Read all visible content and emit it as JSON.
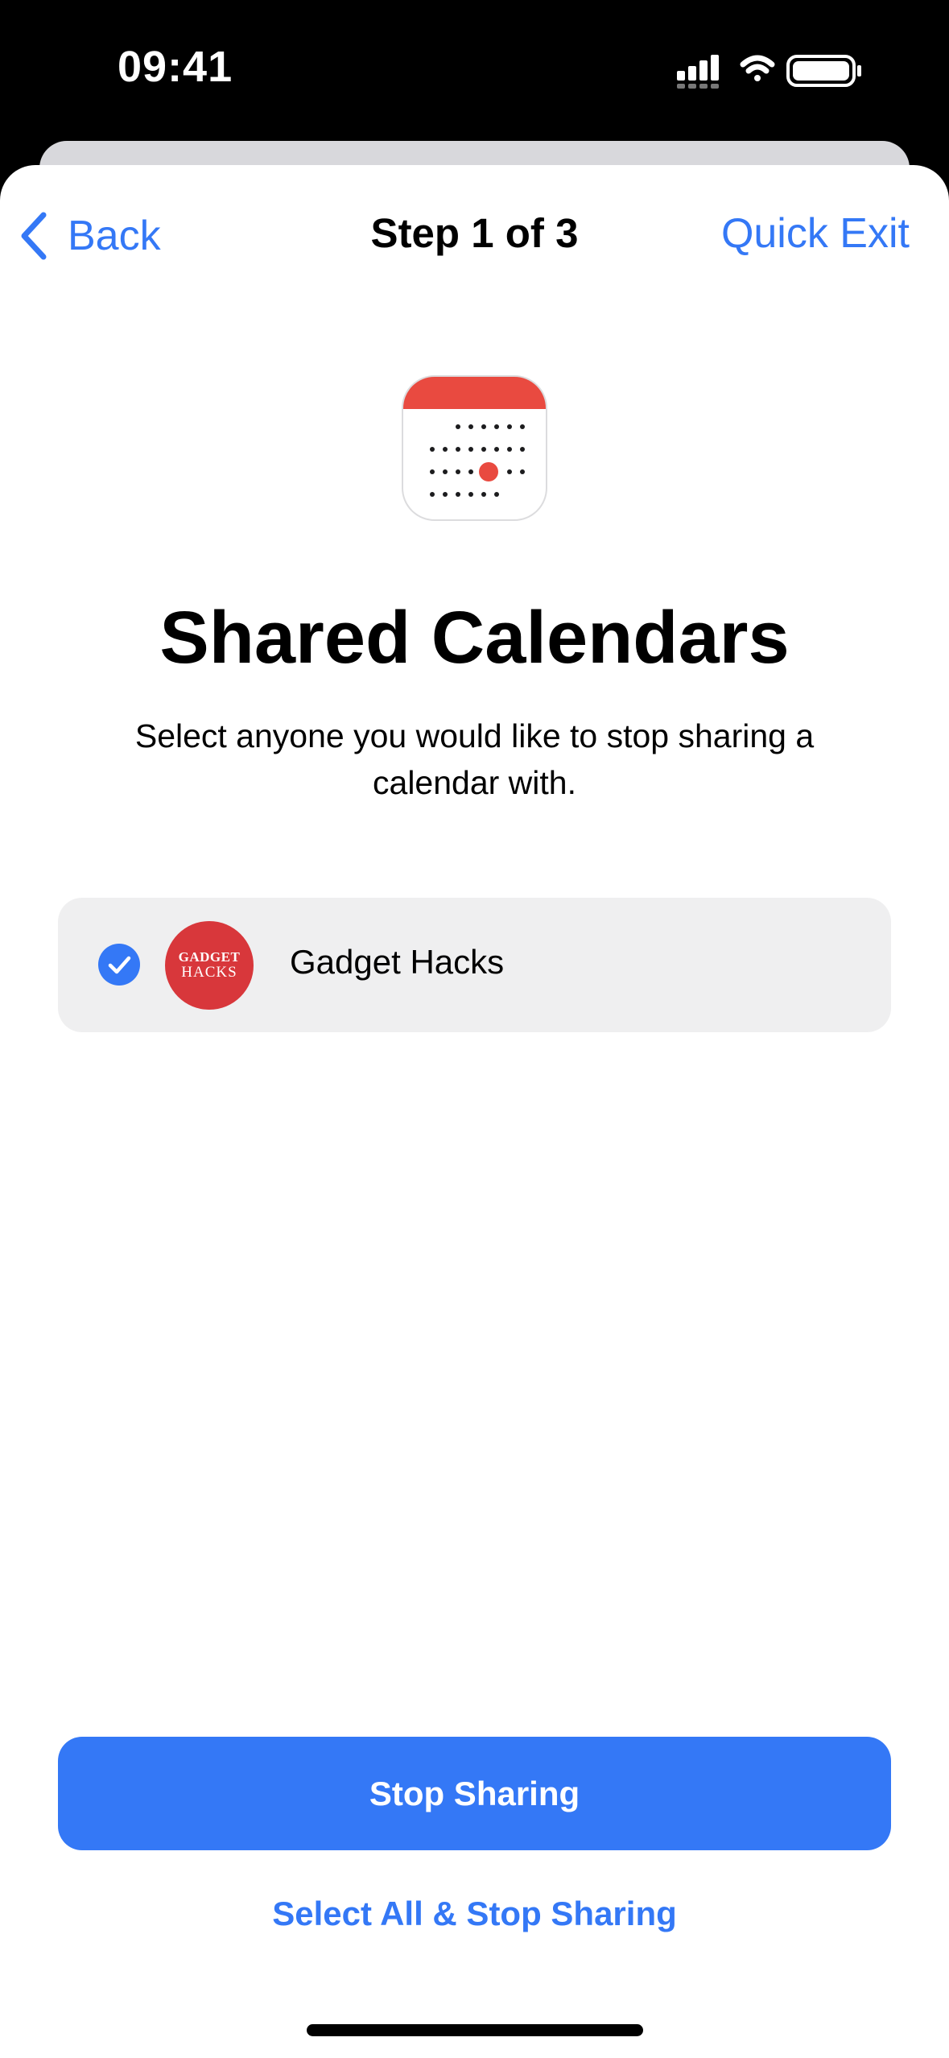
{
  "status_bar": {
    "time": "09:41",
    "icons": [
      "cellular-signal-icon",
      "wifi-icon",
      "battery-icon"
    ]
  },
  "nav": {
    "back_label": "Back",
    "title": "Step 1 of 3",
    "quick_exit_label": "Quick Exit"
  },
  "header": {
    "icon": "calendar-app-icon",
    "title": "Shared Calendars",
    "description": "Select anyone you would like to stop sharing a calendar with."
  },
  "people": [
    {
      "name": "Gadget Hacks",
      "avatar_text_line1": "GADGET",
      "avatar_text_line2": "HACKS",
      "selected": true
    }
  ],
  "actions": {
    "primary_label": "Stop Sharing",
    "secondary_label": "Select All & Stop Sharing"
  },
  "colors": {
    "accent": "#3478f6",
    "calendar_red": "#e94a40",
    "avatar_red": "#d8373b",
    "row_background": "#efeff0"
  }
}
